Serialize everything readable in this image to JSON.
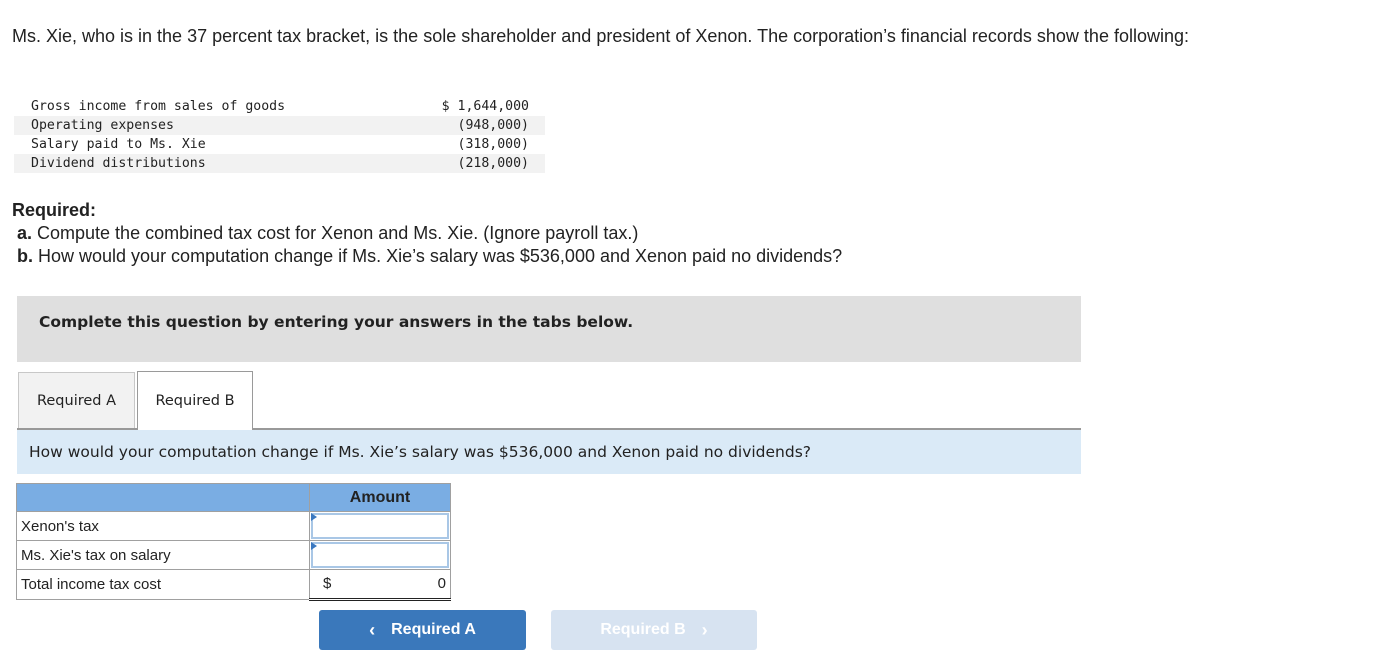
{
  "intro": "Ms. Xie, who is in the 37 percent tax bracket, is the sole shareholder and president of Xenon. The corporation’s financial records show the following:",
  "financials": [
    {
      "label": "Gross income from sales of goods",
      "value": "$ 1,644,000"
    },
    {
      "label": "Operating expenses",
      "value": "(948,000)"
    },
    {
      "label": "Salary paid to Ms. Xie",
      "value": "(318,000)"
    },
    {
      "label": "Dividend distributions",
      "value": "(218,000)"
    }
  ],
  "required": {
    "title": "Required:",
    "items": [
      {
        "letter": "a.",
        "text": " Compute the combined tax cost for Xenon and Ms. Xie. (Ignore payroll tax.)"
      },
      {
        "letter": "b.",
        "text": " How would your computation change if Ms. Xie’s salary was $536,000 and Xenon paid no dividends?"
      }
    ]
  },
  "instructions": "Complete this question by entering your answers in the tabs below.",
  "tabs": [
    {
      "label": "Required A",
      "active": false
    },
    {
      "label": "Required B",
      "active": true
    }
  ],
  "question": "How would your computation change if Ms. Xie’s salary was $536,000 and Xenon paid no dividends?",
  "answer_table": {
    "header": {
      "label": "",
      "amount": "Amount"
    },
    "rows": [
      {
        "label": "Xenon's tax",
        "value": ""
      },
      {
        "label": "Ms. Xie's tax on salary",
        "value": ""
      }
    ],
    "total": {
      "label": "Total income tax cost",
      "currency": "$",
      "value": "0"
    }
  },
  "nav": {
    "prev_label": "Required A",
    "next_label": "Required B",
    "prev_icon": "‹",
    "next_icon": "›"
  }
}
